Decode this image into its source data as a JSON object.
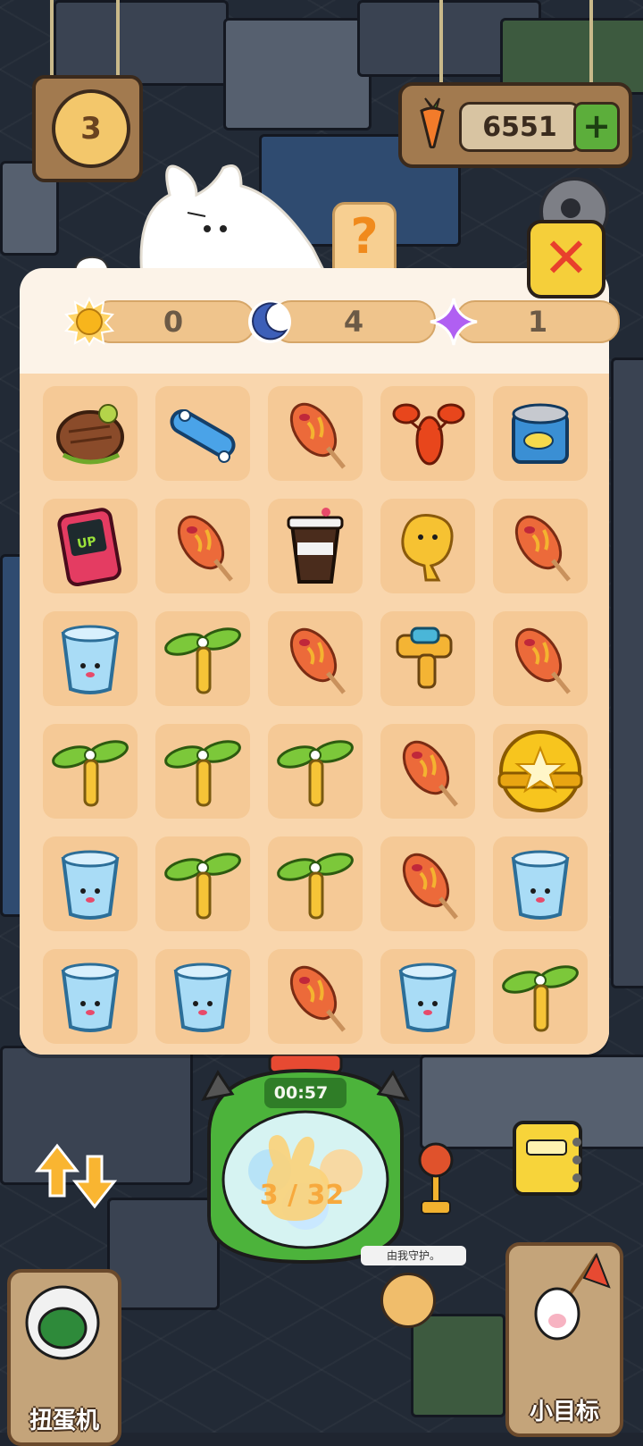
{
  "hud": {
    "level": "3",
    "carrots": "6551",
    "plus": "+"
  },
  "panel": {
    "help": "?",
    "close": "✕",
    "stats": [
      {
        "icon": "sun-icon",
        "value": "0"
      },
      {
        "icon": "moon-icon",
        "value": "4"
      },
      {
        "icon": "sparkle-icon",
        "value": "1"
      }
    ],
    "grid": [
      [
        "steak",
        "skateboard",
        "corndog",
        "lobster",
        "canned-fish"
      ],
      [
        "level-up-console",
        "corndog",
        "iced-coffee",
        "fried-chicken",
        "corndog"
      ],
      [
        "glass-cup",
        "propeller",
        "corndog",
        "water-gun",
        "corndog"
      ],
      [
        "propeller",
        "propeller",
        "propeller",
        "corndog",
        "golden-star-capsule"
      ],
      [
        "glass-cup",
        "propeller",
        "propeller",
        "corndog",
        "glass-cup"
      ],
      [
        "glass-cup",
        "glass-cup",
        "corndog",
        "glass-cup",
        "propeller"
      ]
    ]
  },
  "machine": {
    "timer": "00:57",
    "progress": "3 / 32"
  },
  "bottom": {
    "left_label": "扭蛋机",
    "right_label": "小目标",
    "bubble": "由我守护。"
  },
  "colors": {
    "panel": "#fcf3e8",
    "grid_bg": "#f9d6ad",
    "cell": "#f5c996",
    "machine_green": "#4cb33b",
    "close_yellow": "#f5cf3a"
  }
}
